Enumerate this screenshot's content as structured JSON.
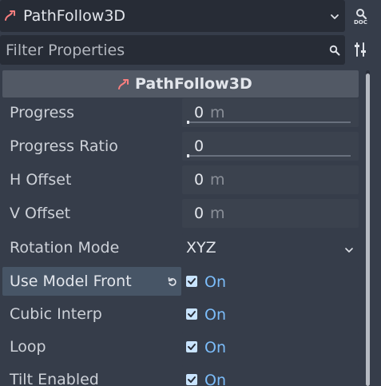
{
  "node_selector": {
    "name": "PathFollow3D",
    "icon": "path-follow-icon"
  },
  "doc_button": {
    "label": "DOC",
    "icon": "doc-icon"
  },
  "filter": {
    "placeholder": "Filter Properties",
    "icon": "search-icon"
  },
  "tools_icon": "sliders-icon",
  "section": {
    "title": "PathFollow3D",
    "icon": "path-follow-icon"
  },
  "properties": [
    {
      "label": "Progress",
      "value": "0",
      "unit": "m",
      "kind": "slider"
    },
    {
      "label": "Progress Ratio",
      "value": "0",
      "unit": "",
      "kind": "slider"
    },
    {
      "label": "H Offset",
      "value": "0",
      "unit": "m",
      "kind": "number"
    },
    {
      "label": "V Offset",
      "value": "0",
      "unit": "m",
      "kind": "number"
    },
    {
      "label": "Rotation Mode",
      "value": "XYZ",
      "kind": "enum"
    },
    {
      "label": "Use Model Front",
      "value": "On",
      "kind": "bool",
      "checked": true,
      "highlighted": true
    },
    {
      "label": "Cubic Interp",
      "value": "On",
      "kind": "bool",
      "checked": true
    },
    {
      "label": "Loop",
      "value": "On",
      "kind": "bool",
      "checked": true
    },
    {
      "label": "Tilt Enabled",
      "value": "On",
      "kind": "bool",
      "checked": true
    }
  ],
  "colors": {
    "background": "#363d4a",
    "field": "#272c36",
    "header": "#525965",
    "accent": "#7cbdfa",
    "node_icon": "#fc7f7f"
  }
}
